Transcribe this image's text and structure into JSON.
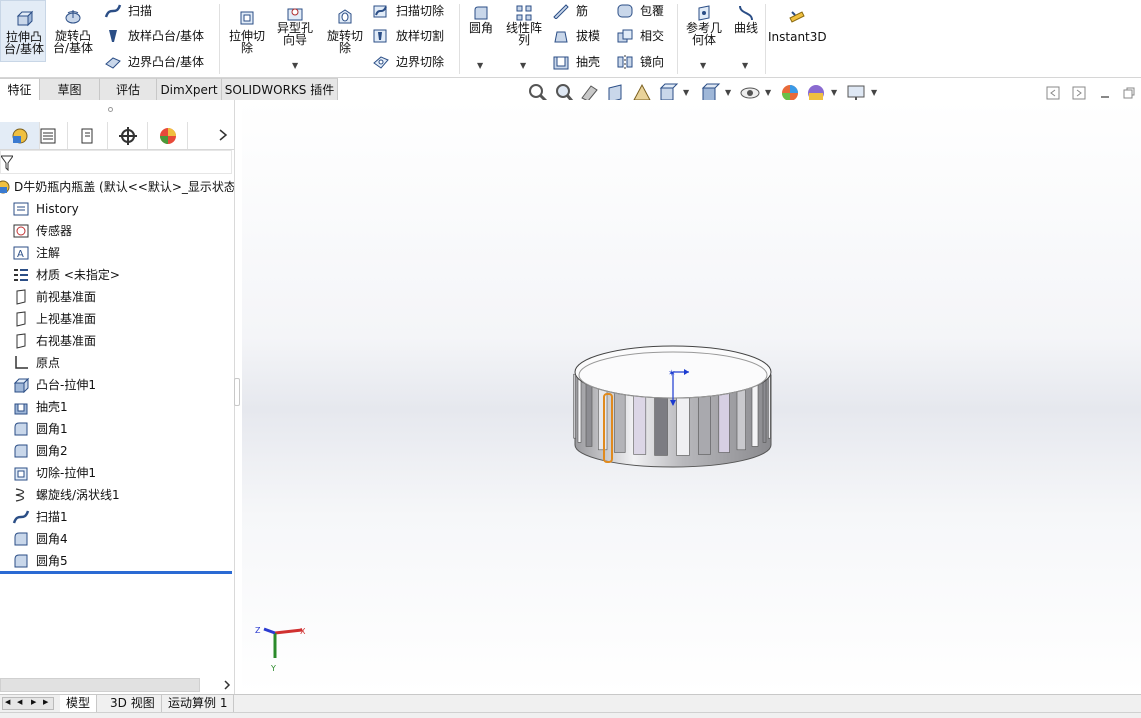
{
  "ribbon": {
    "extrude_boss": "拉伸凸\n台/基体",
    "revolve_boss": "旋转凸\n台/基体",
    "sweep": "扫描",
    "loft_boss": "放样凸台/基体",
    "boundary_boss": "边界凸台/基体",
    "extrude_cut": "拉伸切\n除",
    "hole_wizard": "异型孔\n向导",
    "revolve_cut": "旋转切\n除",
    "swept_cut": "扫描切除",
    "lofted_cut": "放样切割",
    "boundary_cut": "边界切除",
    "fillet": "圆角",
    "linear_pattern": "线性阵\n列",
    "rib": "筋",
    "draft": "拔模",
    "shell": "抽壳",
    "wrap": "包覆",
    "intersect": "相交",
    "mirror": "镜向",
    "ref_geometry": "参考几\n何体",
    "curves": "曲线",
    "instant3d": "Instant3D"
  },
  "tabs": [
    "特征",
    "草图",
    "评估",
    "DimXpert",
    "SOLIDWORKS 插件"
  ],
  "tree": {
    "root": "D牛奶瓶内瓶盖 (默认<<默认>_显示状态",
    "items": [
      {
        "label": "History",
        "icon": "history-icon"
      },
      {
        "label": "传感器",
        "icon": "sensor-icon"
      },
      {
        "label": "注解",
        "icon": "annotation-icon"
      },
      {
        "label": "材质 <未指定>",
        "icon": "material-icon"
      },
      {
        "label": "前视基准面",
        "icon": "plane-icon"
      },
      {
        "label": "上视基准面",
        "icon": "plane-icon"
      },
      {
        "label": "右视基准面",
        "icon": "plane-icon"
      },
      {
        "label": "原点",
        "icon": "origin-icon"
      },
      {
        "label": "凸台-拉伸1",
        "icon": "extrude-icon"
      },
      {
        "label": "抽壳1",
        "icon": "shell-icon"
      },
      {
        "label": "圆角1",
        "icon": "fillet-icon"
      },
      {
        "label": "圆角2",
        "icon": "fillet-icon"
      },
      {
        "label": "切除-拉伸1",
        "icon": "cut-extrude-icon"
      },
      {
        "label": "螺旋线/涡状线1",
        "icon": "helix-icon"
      },
      {
        "label": "扫描1",
        "icon": "sweep-icon"
      },
      {
        "label": "圆角4",
        "icon": "fillet-icon"
      },
      {
        "label": "圆角5",
        "icon": "fillet-icon"
      }
    ]
  },
  "bottom_tabs": [
    "模型",
    "3D 视图",
    "运动算例 1"
  ],
  "triad": {
    "x": "X",
    "y": "Y",
    "z": "Z"
  },
  "colors": {
    "accent": "#2a6ad3",
    "selected_edge": "#e08a1e"
  }
}
